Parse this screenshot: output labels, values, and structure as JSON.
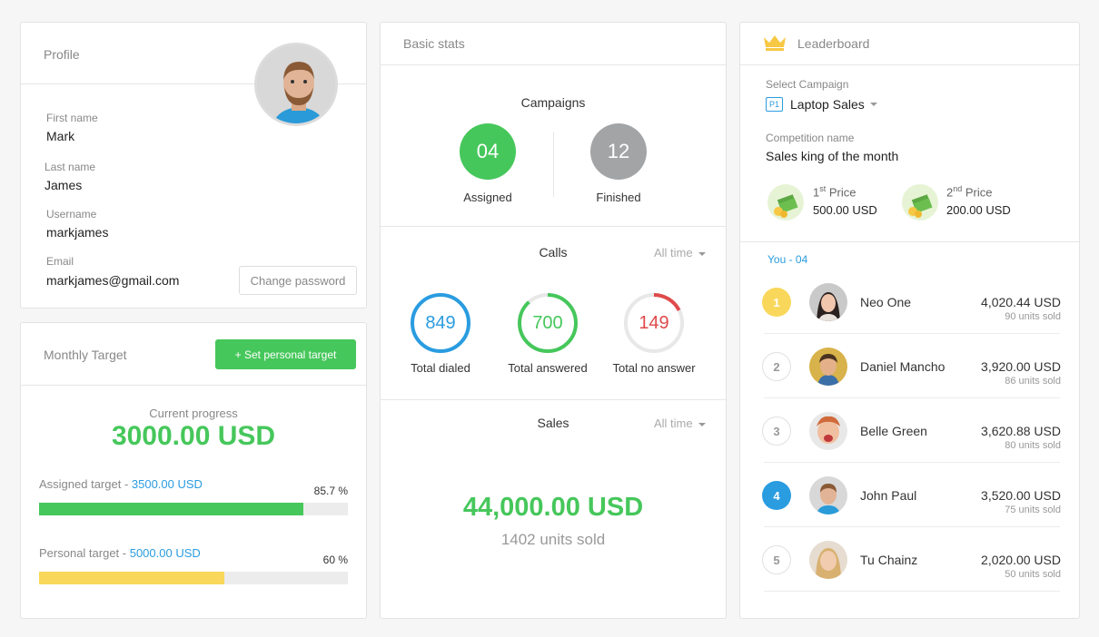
{
  "profile": {
    "title": "Profile",
    "first_name_label": "First name",
    "first_name": "Mark",
    "last_name_label": "Last name",
    "last_name": "James",
    "username_label": "Username",
    "username": "markjames",
    "email_label": "Email",
    "email": "markjames@gmail.com",
    "change_password": "Change password"
  },
  "target": {
    "title": "Monthly Target",
    "set_button": "+ Set personal target",
    "progress_label": "Current progress",
    "progress_value": "3000.00 USD",
    "assigned_label": "Assigned target - ",
    "assigned_value": "3500.00 USD",
    "assigned_pct_label": "85.7 %",
    "assigned_pct": 85.7,
    "personal_label": "Personal target - ",
    "personal_value": "5000.00 USD",
    "personal_pct_label": "60 %",
    "personal_pct": 60,
    "colors": {
      "green": "#46c75b",
      "yellow": "#f9d75a",
      "blue": "#2a9ce0"
    }
  },
  "stats": {
    "title": "Basic stats",
    "campaigns_title": "Campaigns",
    "assigned_num": "04",
    "assigned_label": "Assigned",
    "finished_num": "12",
    "finished_label": "Finished",
    "calls_title": "Calls",
    "calls_filter": "All time",
    "dialed": "849",
    "dialed_label": "Total dialed",
    "answered": "700",
    "answered_label": "Total answered",
    "no_answer": "149",
    "no_answer_label": "Total no answer",
    "sales_title": "Sales",
    "sales_filter": "All time",
    "sales_amount": "44,000.00 USD",
    "sales_units": "1402 units sold"
  },
  "leaderboard": {
    "title": "Leaderboard",
    "select_label": "Select Campaign",
    "campaign_badge": "P1",
    "campaign_name": "Laptop Sales",
    "competition_label": "Competition name",
    "competition_name": "Sales king of the month",
    "prize1_num": "1",
    "prize1_sup": "st",
    "prize1_label": " Price",
    "prize1_value": "500.00 USD",
    "prize2_num": "2",
    "prize2_sup": "nd",
    "prize2_label": " Price",
    "prize2_value": "200.00 USD",
    "you_label": "You - 04",
    "rows": [
      {
        "rank": "1",
        "name": "Neo One",
        "amount": "4,020.44 USD",
        "units": "90 units sold"
      },
      {
        "rank": "2",
        "name": "Daniel Mancho",
        "amount": "3,920.00 USD",
        "units": "86 units sold"
      },
      {
        "rank": "3",
        "name": "Belle Green",
        "amount": "3,620.88 USD",
        "units": "80 units sold"
      },
      {
        "rank": "4",
        "name": "John Paul",
        "amount": "3,520.00 USD",
        "units": "75 units sold"
      },
      {
        "rank": "5",
        "name": "Tu Chainz",
        "amount": "2,020.00 USD",
        "units": "50 units sold"
      }
    ]
  }
}
